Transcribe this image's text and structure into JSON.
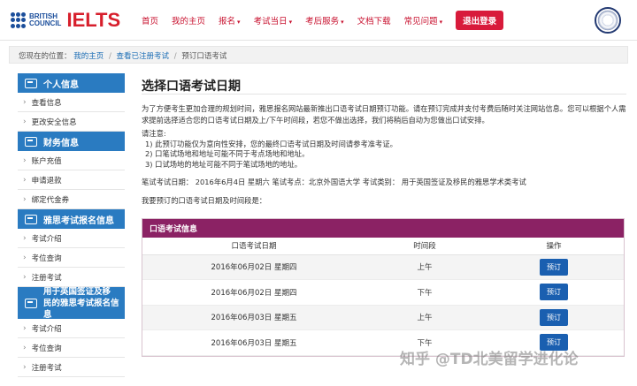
{
  "header": {
    "brand_line1": "BRITISH",
    "brand_line2": "COUNCIL",
    "logo_text": "IELTS",
    "nav": [
      {
        "label": "首页",
        "dropdown": false
      },
      {
        "label": "我的主页",
        "dropdown": false
      },
      {
        "label": "报名",
        "dropdown": true
      },
      {
        "label": "考试当日",
        "dropdown": true
      },
      {
        "label": "考后服务",
        "dropdown": true
      },
      {
        "label": "文档下载",
        "dropdown": false
      },
      {
        "label": "常见问题",
        "dropdown": true
      }
    ],
    "logout_label": "退出登录",
    "seal_icon": "emblem-icon",
    "caret": "▾"
  },
  "breadcrumb": {
    "prefix": "您现在的位置：",
    "link1": "我的主页",
    "link2": "查看已注册考试",
    "current": "预订口语考试",
    "separator": "/"
  },
  "sidebar": {
    "sections": [
      {
        "title": "个人信息",
        "items": [
          "查看信息",
          "更改安全信息"
        ]
      },
      {
        "title": "财务信息",
        "items": [
          "账户充值",
          "申请退款",
          "绑定代金券"
        ]
      },
      {
        "title": "雅思考试报名信息",
        "items": [
          "考试介绍",
          "考位查询",
          "注册考试"
        ]
      },
      {
        "title_line1": "用于英国签证及移",
        "title_line2": "民的雅思考试报名信息",
        "items": [
          "考试介绍",
          "考位查询",
          "注册考试"
        ]
      }
    ],
    "chevron": "›"
  },
  "main": {
    "title": "选择口语考试日期",
    "intro": "为了方便考生更加合理的规划时间，雅思报名网站最新推出口语考试日期预订功能。请在预订完成并支付考费后随时关注网站信息。您可以根据个人需求提前选择适合您的口语考试日期及上/下午时间段，若您不做出选择，我们将稍后自动为您做出口试安排。",
    "notes_title": "请注意:",
    "notes": [
      "1) 此预订功能仅为意向性安排，您的最终口语考试日期及时间请参考准考证。",
      "2) 口笔试场地和地址可能不同于考点场地和地址。",
      "3) 口试场地的地址可能不同于笔试场地的地址。"
    ],
    "exam_info": "笔试考试日期：  2016年6月4日 星期六    笔试考点：北京外国语大学    考试类别：  用于英国签证及移民的雅思学术类考试",
    "choose_text": "我要预订的口语考试日期及时间段是："
  },
  "panel": {
    "title": "口语考试信息",
    "columns": [
      "口语考试日期",
      "时间段",
      "操作"
    ],
    "rows": [
      {
        "date": "2016年06月02日 星期四",
        "period": "上午",
        "action": "预订"
      },
      {
        "date": "2016年06月02日 星期四",
        "period": "下午",
        "action": "预订"
      },
      {
        "date": "2016年06月03日 星期五",
        "period": "上午",
        "action": "预订"
      },
      {
        "date": "2016年06月03日 星期五",
        "period": "下午",
        "action": "预订"
      }
    ]
  },
  "watermark": "知乎 @TD北美留学进化论",
  "colors": {
    "brand_red": "#d71f2c",
    "nav_red": "#c8102e",
    "sidebar_blue": "#2a7bc1",
    "panel_purple": "#8b2264",
    "button_blue": "#1a5fb0"
  }
}
